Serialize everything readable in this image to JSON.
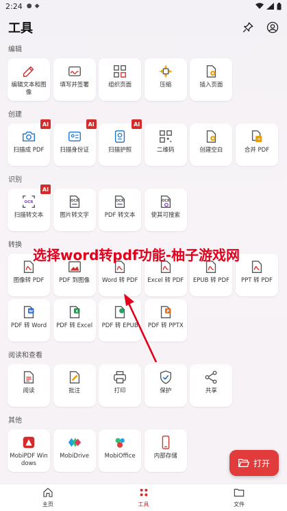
{
  "status": {
    "time": "2:24"
  },
  "app_bar": {
    "title": "工具"
  },
  "sections": [
    {
      "label": "编辑",
      "items": [
        {
          "name": "edit-text",
          "label": "编辑文本和图像",
          "icon": "pen-icon",
          "ai": false
        },
        {
          "name": "fill-sign",
          "label": "填写并签署",
          "icon": "signature-icon",
          "ai": false
        },
        {
          "name": "organize-pages",
          "label": "组织页面",
          "icon": "grid-pages-icon",
          "ai": false
        },
        {
          "name": "compress",
          "label": "压缩",
          "icon": "compress-icon",
          "ai": false
        },
        {
          "name": "insert-page",
          "label": "插入页面",
          "icon": "insert-page-icon",
          "ai": false
        }
      ]
    },
    {
      "label": "创建",
      "items": [
        {
          "name": "scan-to-pdf",
          "label": "扫描成 PDF",
          "icon": "camera-icon",
          "ai": true
        },
        {
          "name": "scan-id",
          "label": "扫描身份证",
          "icon": "id-card-icon",
          "ai": true
        },
        {
          "name": "scan-passport",
          "label": "扫描护照",
          "icon": "passport-icon",
          "ai": true
        },
        {
          "name": "qr-code",
          "label": "二维码",
          "icon": "qr-icon",
          "ai": false
        },
        {
          "name": "create-blank",
          "label": "创建空白",
          "icon": "new-doc-icon",
          "ai": false
        },
        {
          "name": "merge-pdf",
          "label": "合并 PDF",
          "icon": "merge-icon",
          "ai": false
        }
      ]
    },
    {
      "label": "识别",
      "items": [
        {
          "name": "scan-to-text",
          "label": "扫描转文本",
          "icon": "ocr-icon",
          "ai": true
        },
        {
          "name": "image-to-text",
          "label": "图片转文字",
          "icon": "ocr-doc-icon",
          "ai": false
        },
        {
          "name": "pdf-to-text",
          "label": "PDF 转文本",
          "icon": "ocr-doc-icon",
          "ai": false
        },
        {
          "name": "make-searchable",
          "label": "使其可搜索",
          "icon": "ocr-search-icon",
          "ai": false
        }
      ]
    },
    {
      "label": "转换",
      "items": [
        {
          "name": "image-to-pdf",
          "label": "图像转 PDF",
          "icon": "pdf-icon",
          "ai": false
        },
        {
          "name": "pdf-to-image",
          "label": "PDF 到图像",
          "icon": "image-icon",
          "ai": false
        },
        {
          "name": "word-to-pdf",
          "label": "Word 转 PDF",
          "icon": "pdf-icon",
          "ai": false
        },
        {
          "name": "excel-to-pdf",
          "label": "Excel 转 PDF",
          "icon": "pdf-icon",
          "ai": false
        },
        {
          "name": "epub-to-pdf",
          "label": "EPUB 转 PDF",
          "icon": "pdf-icon",
          "ai": false
        },
        {
          "name": "ppt-to-pdf",
          "label": "PPT 转 PDF",
          "icon": "pdf-icon",
          "ai": false
        },
        {
          "name": "pdf-to-word",
          "label": "PDF 转 Word",
          "icon": "word-icon",
          "ai": false
        },
        {
          "name": "pdf-to-excel",
          "label": "PDF 转 Excel",
          "icon": "excel-icon",
          "ai": false
        },
        {
          "name": "pdf-to-epub",
          "label": "PDF 转 EPUB",
          "icon": "epub-icon",
          "ai": false
        },
        {
          "name": "pdf-to-pptx",
          "label": "PDF 转 PPTX",
          "icon": "pptx-icon",
          "ai": false
        }
      ]
    },
    {
      "label": "阅读和查看",
      "items": [
        {
          "name": "read",
          "label": "阅读",
          "icon": "read-icon",
          "ai": false
        },
        {
          "name": "annotate",
          "label": "批注",
          "icon": "annotate-icon",
          "ai": false
        },
        {
          "name": "print",
          "label": "打印",
          "icon": "print-icon",
          "ai": false
        },
        {
          "name": "protect",
          "label": "保护",
          "icon": "shield-icon",
          "ai": false
        },
        {
          "name": "share",
          "label": "共享",
          "icon": "share-icon",
          "ai": false
        }
      ]
    },
    {
      "label": "其他",
      "items": [
        {
          "name": "mobipdf-windows",
          "label": "MobiPDF Windows",
          "icon": "mobipdf-logo-icon",
          "ai": false
        },
        {
          "name": "mobidrive",
          "label": "MobiDrive",
          "icon": "mobidrive-logo-icon",
          "ai": false
        },
        {
          "name": "mobioffice",
          "label": "MobiOffice",
          "icon": "mobioffice-logo-icon",
          "ai": false
        },
        {
          "name": "internal-storage",
          "label": "内部存储",
          "icon": "phone-icon",
          "ai": false
        }
      ]
    }
  ],
  "ai_badge": "AI",
  "overlay": {
    "text": "选择word转pdf功能-柚子游戏网"
  },
  "fab": {
    "label": "打开"
  },
  "bottom_nav": [
    {
      "name": "home",
      "label": "主页",
      "icon": "home-icon",
      "active": false
    },
    {
      "name": "tools",
      "label": "工具",
      "icon": "tools-icon",
      "active": true
    },
    {
      "name": "files",
      "label": "文件",
      "icon": "folder-icon",
      "active": false
    }
  ],
  "colors": {
    "accent": "#d42b2b",
    "overlay_text": "#e0001b"
  }
}
